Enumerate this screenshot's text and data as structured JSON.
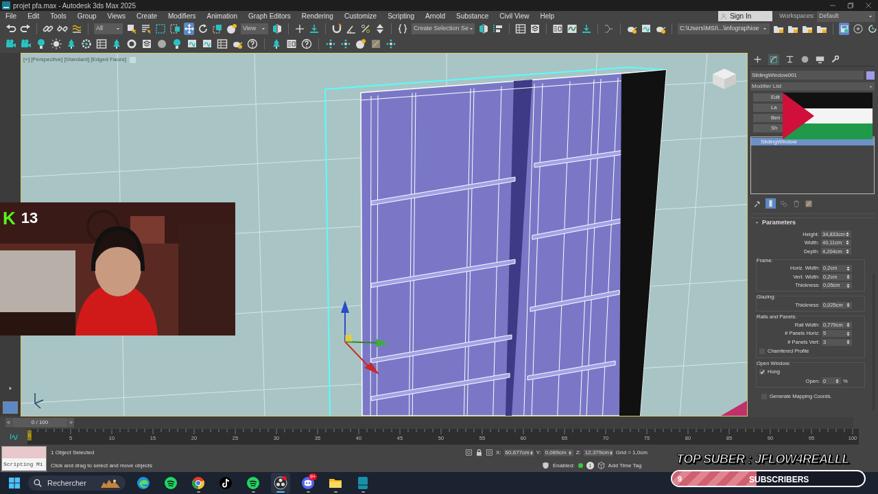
{
  "window": {
    "title": "projet pfa.max - Autodesk 3ds Max 2025"
  },
  "menu": [
    "File",
    "Edit",
    "Tools",
    "Group",
    "Views",
    "Create",
    "Modifiers",
    "Animation",
    "Graph Editors",
    "Rendering",
    "Customize",
    "Scripting",
    "Arnold",
    "Substance",
    "Civil View",
    "Help"
  ],
  "account": {
    "sign_in": "Sign In",
    "workspaces_label": "Workspaces:",
    "workspace": "Default"
  },
  "toolbar": {
    "selection_filter": "All",
    "reference_coord": "View",
    "named_selection": "Create Selection Se",
    "project_path": "C:\\Users\\MSI\\...\\infographioe"
  },
  "viewport": {
    "labels": [
      "[+]",
      "[Perspective]",
      "[Standard]",
      "[Edged Faces]"
    ]
  },
  "command_panel": {
    "object_name": "SlidingWindow001",
    "modifier_list": "Modifier List",
    "modifier_buttons": [
      "Edit",
      "La",
      "Ben",
      "Sh"
    ],
    "stack": [
      {
        "label": "SlidingWindow",
        "selected": true
      }
    ],
    "rollout": "Parameters",
    "params": [
      {
        "kind": "spinner",
        "label": "Height:",
        "value": "34,833cm"
      },
      {
        "kind": "spinner",
        "label": "Width:",
        "value": "40,11cm"
      },
      {
        "kind": "spinner",
        "label": "Depth:",
        "value": "4,204cm"
      },
      {
        "kind": "group",
        "title": "Frame:",
        "rows": [
          {
            "kind": "spinner",
            "label": "Horiz. Width:",
            "value": "0,2cm"
          },
          {
            "kind": "spinner",
            "label": "Vert. Width:",
            "value": "0,2cm"
          },
          {
            "kind": "spinner",
            "label": "Thickness:",
            "value": "0,05cm"
          }
        ]
      },
      {
        "kind": "group",
        "title": "Glazing:",
        "rows": [
          {
            "kind": "spinner",
            "label": "Thickness:",
            "value": "0,025cm"
          }
        ]
      },
      {
        "kind": "group",
        "title": "Rails and Panels:",
        "rows": [
          {
            "kind": "spinner",
            "label": "Rail Width:",
            "value": "0,779cm"
          },
          {
            "kind": "spinner",
            "label": "# Panels Horiz:",
            "value": "5"
          },
          {
            "kind": "spinner",
            "label": "# Panels Vert:",
            "value": "3"
          },
          {
            "kind": "checkbox",
            "label": "Chamfered Profile",
            "checked": false
          }
        ]
      },
      {
        "kind": "group",
        "title": "Open Window:",
        "rows": [
          {
            "kind": "checkbox",
            "label": "Hung",
            "checked": true
          },
          {
            "kind": "spinner",
            "label": "Open:",
            "value": "0",
            "suffix": "%"
          }
        ]
      },
      {
        "kind": "checkbox",
        "label": "Generate Mapping Coords.",
        "checked": false
      }
    ]
  },
  "timeline": {
    "prev": "<",
    "counter": "0 / 100",
    "level": 0,
    "next": ">",
    "current": "0",
    "ticks": [
      "5",
      "10",
      "15",
      "20",
      "25",
      "30",
      "35",
      "40",
      "45",
      "50",
      "55",
      "60",
      "65",
      "70",
      "75",
      "80",
      "85",
      "90",
      "95",
      "100"
    ]
  },
  "status": {
    "script_field": "Scripting Mi",
    "selection": "1 Object Selected",
    "prompt": "Click and drag to select and move objects",
    "coords": [
      {
        "axis": "X:",
        "value": "60,677cm"
      },
      {
        "axis": "Y:",
        "value": "0,089cm"
      },
      {
        "axis": "Z:",
        "value": "12,379cm"
      }
    ],
    "grid": "Grid = 1,0cm",
    "enabled_label": "Enabled:",
    "enabled_count": "1",
    "add_time_tag": "Add Time Tag"
  },
  "taskbar": {
    "search_placeholder": "Rechercher",
    "apps": [
      {
        "kind": "edge",
        "running": false,
        "active": false
      },
      {
        "kind": "spotify",
        "running": false,
        "active": false
      },
      {
        "kind": "chrome",
        "running": true,
        "active": false
      },
      {
        "kind": "tiktok",
        "running": false,
        "active": false
      },
      {
        "kind": "spotify",
        "running": true,
        "active": false
      },
      {
        "kind": "obs",
        "running": true,
        "active": true
      },
      {
        "kind": "discord",
        "running": true,
        "active": false,
        "badge": "9+"
      },
      {
        "kind": "files",
        "running": true,
        "active": false
      },
      {
        "kind": "max",
        "running": true,
        "active": false
      }
    ]
  },
  "stream_overlay": {
    "kick_logo": "K",
    "kick_count": "13",
    "top_suber": "TOP SUBER : JFLOW4REALLL",
    "sub_count": "9",
    "sub_label": "SUBSCRIBERS",
    "level": 0.44
  }
}
